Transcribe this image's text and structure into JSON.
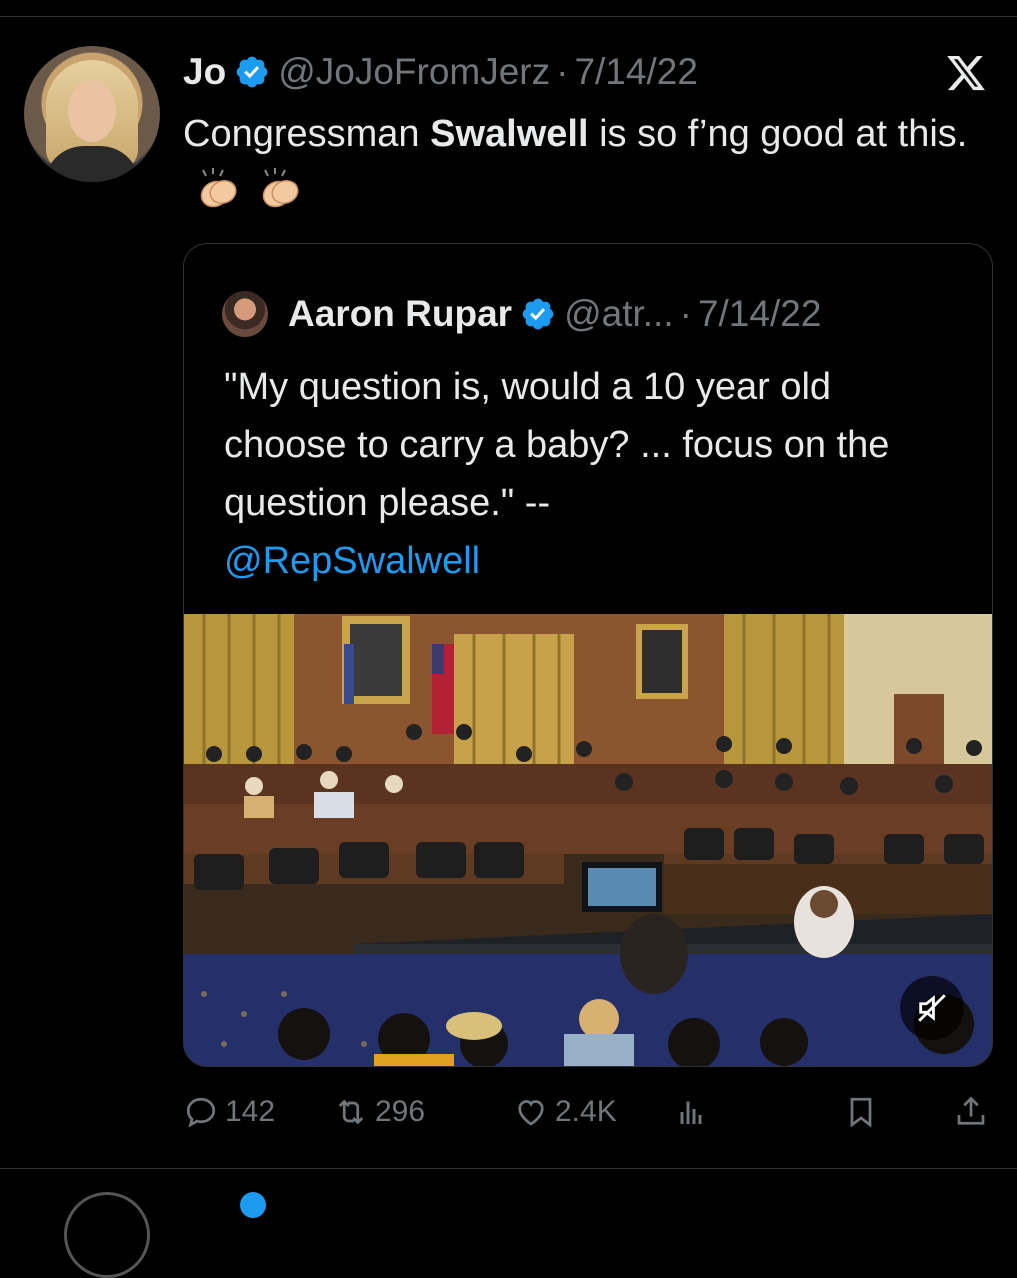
{
  "tweet": {
    "author_name": "Jo",
    "handle": "@JoJoFromJerz",
    "separator": "·",
    "date": "7/14/22",
    "text_before": "Congressman ",
    "text_bold": "Swalwell",
    "text_after": " is so f’ng good at this.",
    "emoji": "clapping-hands-icon"
  },
  "quoted_tweet": {
    "author_name": "Aaron Rupar",
    "handle": "@atr...",
    "separator": "·",
    "date": "7/14/22",
    "text": "\"My question is, would a 10 year old choose to carry a baby? ... focus on the question please.\" --",
    "mention": "@RepSwalwell"
  },
  "actions": {
    "replies": "142",
    "retweets": "296",
    "likes": "2.4K"
  },
  "colors": {
    "background": "#000000",
    "text": "#e7e9ea",
    "muted": "#71767b",
    "accent": "#1d9bf0",
    "border": "#2f3336"
  }
}
